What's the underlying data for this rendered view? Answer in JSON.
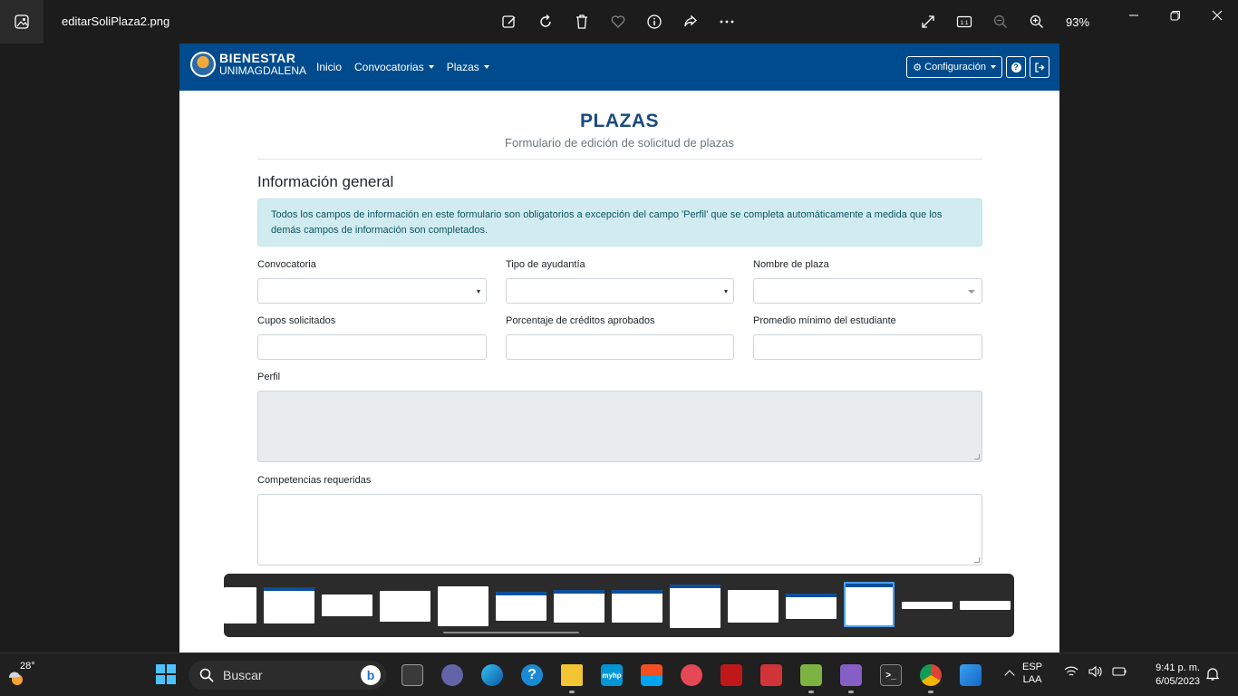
{
  "viewer": {
    "file_name": "editarSoliPlaza2.png",
    "zoom": "93%",
    "tools": [
      "edit-image-icon",
      "rotate-icon",
      "delete-icon",
      "favorite-icon",
      "info-icon",
      "share-icon",
      "more-icon"
    ],
    "right_tools": [
      "fullscreen-icon",
      "actual-size-icon",
      "zoom-out-icon",
      "zoom-in-icon"
    ],
    "actual_size_label": "1:1"
  },
  "app": {
    "brand_line1": "BIENESTAR",
    "brand_line2": "UNIMAGDALENA",
    "nav": {
      "inicio": "Inicio",
      "convocatorias": "Convocatorias",
      "plazas": "Plazas"
    },
    "config_label": "Configuración",
    "help_label": "?",
    "accent": "#004b8d"
  },
  "page": {
    "title": "PLAZAS",
    "subtitle": "Formulario de edición de solicitud de plazas",
    "section_title": "Información general",
    "alert_text": "Todos los campos de información en este formulario son obligatorios a excepción del campo 'Perfil' que se completa automáticamente a medida que los demás campos de información son completados."
  },
  "form": {
    "convocatoria_label": "Convocatoria",
    "tipo_label": "Tipo de ayudantía",
    "nombre_label": "Nombre de plaza",
    "cupos_label": "Cupos solicitados",
    "porcentaje_label": "Porcentaje de créditos aprobados",
    "promedio_label": "Promedio mínimo del estudiante",
    "perfil_label": "Perfil",
    "competencias_label": "Competencias requeridas"
  },
  "taskbar": {
    "temperature": "28°",
    "search_placeholder": "Buscar",
    "bing_letter": "b",
    "apps": [
      "task-view",
      "teams",
      "edge",
      "help",
      "file-explorer",
      "myhp",
      "store",
      "snipping",
      "mcafee",
      "toolbox",
      "visual-studio-code",
      "visual-studio",
      "terminal",
      "chrome",
      "photos"
    ],
    "myhp_label": "myhp",
    "lang_line1": "ESP",
    "lang_line2": "LAA",
    "time": "9:41 p. m.",
    "date": "6/05/2023"
  }
}
